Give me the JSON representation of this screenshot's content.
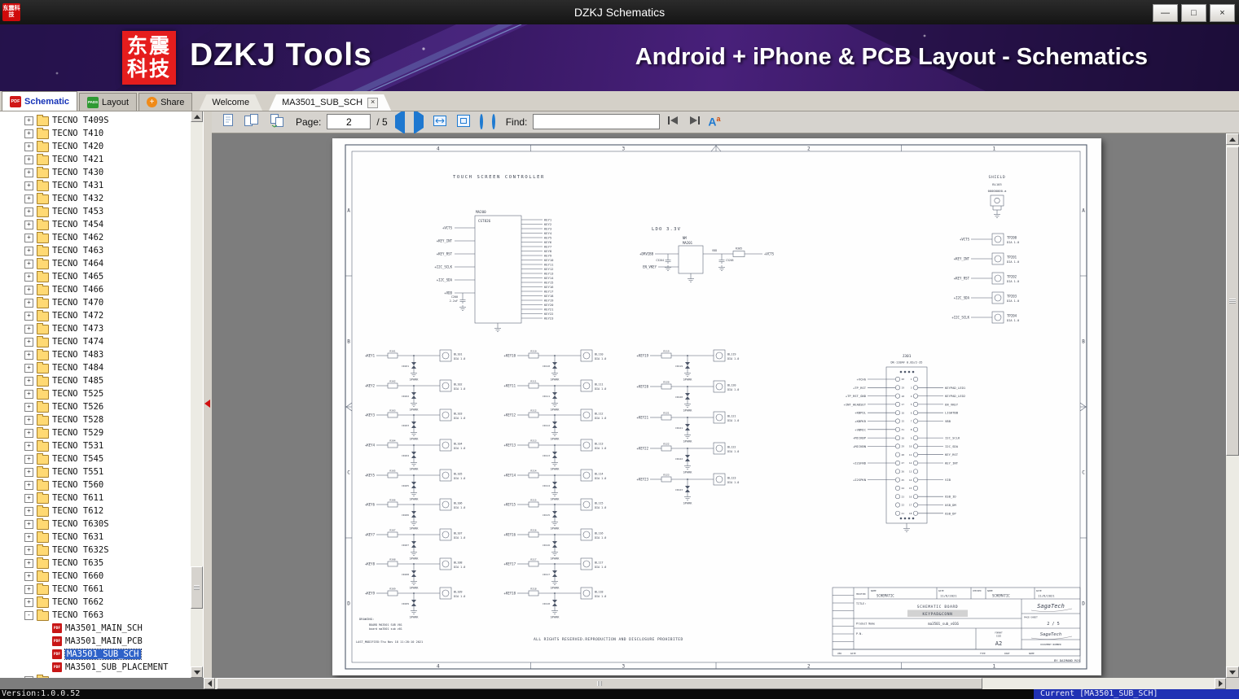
{
  "window": {
    "title": "DZKJ Schematics",
    "icon_text": "东震科技",
    "controls": {
      "minimize": "—",
      "maximize": "□",
      "close": "×"
    }
  },
  "banner": {
    "logo_line1": "东震",
    "logo_line2": "科技",
    "brand": "DZKJ Tools",
    "subtitle": "Android + iPhone & PCB Layout - Schematics"
  },
  "icons": {
    "pdf": "PDF",
    "pads": "PADS",
    "share": "+",
    "match_a": "A",
    "match_a_sup": "a"
  },
  "tabs": {
    "app": [
      {
        "label": "Schematic"
      },
      {
        "label": "Layout"
      },
      {
        "label": "Share"
      }
    ],
    "docs": [
      {
        "label": "Welcome"
      },
      {
        "label": "MA3501_SUB_SCH",
        "close": "×"
      }
    ]
  },
  "sidebar": {
    "folders": [
      "TECNO T409S",
      "TECNO T410",
      "TECNO T420",
      "TECNO T421",
      "TECNO T430",
      "TECNO T431",
      "TECNO T432",
      "TECNO T453",
      "TECNO T454",
      "TECNO T462",
      "TECNO T463",
      "TECNO T464",
      "TECNO T465",
      "TECNO T466",
      "TECNO T470",
      "TECNO T472",
      "TECNO T473",
      "TECNO T474",
      "TECNO T483",
      "TECNO T484",
      "TECNO T485",
      "TECNO T525",
      "TECNO T526",
      "TECNO T528",
      "TECNO T529",
      "TECNO T531",
      "TECNO T545",
      "TECNO T551",
      "TECNO T560",
      "TECNO T611",
      "TECNO T612",
      "TECNO T630S",
      "TECNO T631",
      "TECNO T632S",
      "TECNO T635",
      "TECNO T660",
      "TECNO T661",
      "TECNO T662",
      "TECNO T663"
    ],
    "expanded": "TECNO T663",
    "children": [
      {
        "label": "MA3501_MAIN_SCH",
        "selected": false
      },
      {
        "label": "MA3501_MAIN_PCB",
        "selected": false
      },
      {
        "label": "MA3501_SUB_SCH",
        "selected": true
      },
      {
        "label": "MA3501_SUB_PLACEMENT",
        "selected": false
      }
    ]
  },
  "toolbar": {
    "page_label": "Page:",
    "page_value": "2",
    "page_total": "/ 5",
    "find_label": "Find:",
    "find_value": ""
  },
  "statusbar": {
    "version": "Version:1.0.0.52",
    "current": "Current [MA3501_SUB_SCH]"
  },
  "schematic": {
    "frame": {
      "cols": [
        "4",
        "3",
        "2",
        "1"
      ],
      "rows": [
        "A",
        "B",
        "C",
        "D"
      ]
    },
    "touch": {
      "title": "TOUCH SCREEN CONTROLLER",
      "ref": "MA200",
      "part": "CST826",
      "left_nets": [
        "VCTS",
        "KEY_INT",
        "KEY_RST",
        "I2C_SCLK",
        "I2C_SDA",
        "VDD"
      ],
      "cap_ref": "C200",
      "cap_val": "2.2uF",
      "right_nets": [
        "KEY1",
        "KEY2",
        "KEY3",
        "KEY4",
        "KEY5",
        "KEY6",
        "KEY7",
        "KEY8",
        "KEY9",
        "KEY10",
        "KEY11",
        "KEY12",
        "KEY13",
        "KEY14",
        "KEY15",
        "KEY16",
        "KEY17",
        "KEY18",
        "KEY19",
        "KEY20",
        "KEY21",
        "KEY22",
        "KEY23"
      ]
    },
    "ldo": {
      "title": "LDO 3.3V",
      "nm": "NM",
      "ref": "MA201",
      "in_net": "DRVIBB",
      "en_net": "EN_VKEY",
      "mid_net": "VDD",
      "out_net": "VCTS",
      "res_ref": "R305",
      "cap1": "C3204",
      "cap2": "C3205"
    },
    "shield": {
      "title": "SHIELD",
      "ref": "BL103",
      "part": "00000000-a"
    },
    "testpoints": [
      {
        "net": "VCTS",
        "ref": "TP200",
        "dia": "DIA 1.0"
      },
      {
        "net": "KEY_INT",
        "ref": "TP201",
        "dia": "DIA 1.0"
      },
      {
        "net": "KEY_RST",
        "ref": "TP202",
        "dia": "DIA 1.0"
      },
      {
        "net": "I2C_SDA",
        "ref": "TP203",
        "dia": "DIA 1.0"
      },
      {
        "net": "I2C_SCLK",
        "ref": "TP204",
        "dia": "DIA 1.0"
      }
    ],
    "keypad": {
      "sw_note": "DIA 1.0",
      "spark": "SPARK",
      "col1": [
        {
          "net": "KEY1",
          "res": "R301",
          "cap": "CR101",
          "sw": "BL101"
        },
        {
          "net": "KEY2",
          "res": "R302",
          "cap": "CR102",
          "sw": "BL102"
        },
        {
          "net": "KEY3",
          "res": "R303",
          "cap": "CR103",
          "sw": "BL103"
        },
        {
          "net": "KEY4",
          "res": "R304",
          "cap": "CR104",
          "sw": "BL104"
        },
        {
          "net": "KEY5",
          "res": "R305",
          "cap": "CR105",
          "sw": "BL105"
        },
        {
          "net": "KEY6",
          "res": "R306",
          "cap": "CR106",
          "sw": "BL106"
        },
        {
          "net": "KEY7",
          "res": "R307",
          "cap": "CR107",
          "sw": "BL107"
        },
        {
          "net": "KEY8",
          "res": "R308",
          "cap": "CR108",
          "sw": "BL108"
        },
        {
          "net": "KEY9",
          "res": "R309",
          "cap": "CR109",
          "sw": "BL109"
        }
      ],
      "col2": [
        {
          "net": "KEY10",
          "res": "R310",
          "cap": "CR110",
          "sw": "BL110"
        },
        {
          "net": "KEY11",
          "res": "R311",
          "cap": "CR111",
          "sw": "BL111"
        },
        {
          "net": "KEY12",
          "res": "R312",
          "cap": "CR112",
          "sw": "BL112"
        },
        {
          "net": "KEY13",
          "res": "R313",
          "cap": "CR113",
          "sw": "BL113"
        },
        {
          "net": "KEY14",
          "res": "R314",
          "cap": "CR114",
          "sw": "BL114"
        },
        {
          "net": "KEY15",
          "res": "R315",
          "cap": "CR115",
          "sw": "BL115"
        },
        {
          "net": "KEY16",
          "res": "R316",
          "cap": "CR116",
          "sw": "BL116"
        },
        {
          "net": "KEY17",
          "res": "R317",
          "cap": "CR117",
          "sw": "BL117"
        },
        {
          "net": "KEY18",
          "res": "R318",
          "cap": "CR118",
          "sw": "BL118"
        }
      ],
      "col3": [
        {
          "net": "KEY19",
          "res": "R319",
          "cap": "CR119",
          "sw": "BL119"
        },
        {
          "net": "KEY20",
          "res": "R320",
          "cap": "CR120",
          "sw": "BL120"
        },
        {
          "net": "KEY21",
          "res": "R321",
          "cap": "CR121",
          "sw": "BL121"
        },
        {
          "net": "KEY22",
          "res": "R322",
          "cap": "CR122",
          "sw": "BL122"
        },
        {
          "net": "KEY23",
          "res": "R323",
          "cap": "CR123",
          "sw": "BL123"
        }
      ]
    },
    "connector": {
      "ref": "J301",
      "part": "DK-118AF 0.8S/2-35",
      "rows": [
        {
          "l": "20",
          "lnet": "VCHG",
          "r": "1",
          "rnet": ""
        },
        {
          "l": "19",
          "lnet": "TP_RST",
          "r": "3",
          "rnet": "KEYPAD_LED1"
        },
        {
          "l": "18",
          "lnet": "TP_RST_GND",
          "r": "4",
          "rnet": "KEYPAD_LED2"
        },
        {
          "l": "17",
          "lnet": "INT_HEADSET",
          "r": "5",
          "rnet": "EN_VKEY"
        },
        {
          "l": "16",
          "lnet": "KBPOL",
          "r": "6",
          "rnet": "LIGHTBB"
        },
        {
          "l": "15",
          "lnet": "KBPKR",
          "r": "7",
          "rnet": "VBB"
        },
        {
          "l": "31",
          "lnet": "VBMIC",
          "r": "8",
          "rnet": ""
        },
        {
          "l": "30",
          "lnet": "MICKBP",
          "r": "9",
          "rnet": "I2C_SCLK"
        },
        {
          "l": "29",
          "lnet": "MICKBN",
          "r": "10",
          "rnet": "I2C_SDA"
        },
        {
          "l": "28",
          "lnet": "",
          "r": "11",
          "rnet": "KEY_RST"
        },
        {
          "l": "27",
          "lnet": "I2SFND",
          "r": "12",
          "rnet": "KEY_INT"
        },
        {
          "l": "26",
          "lnet": "",
          "r": "13",
          "rnet": ""
        },
        {
          "l": "25",
          "lnet": "I2SPKN",
          "r": "14",
          "rnet": "VIB"
        },
        {
          "l": "24",
          "lnet": "",
          "r": "15",
          "rnet": ""
        },
        {
          "l": "23",
          "lnet": "",
          "r": "16",
          "rnet": "USB_ID"
        },
        {
          "l": "22",
          "lnet": "",
          "r": "17",
          "rnet": "USB_DM"
        },
        {
          "l": "21",
          "lnet": "",
          "r": "18",
          "rnet": "USB_DP"
        }
      ]
    },
    "notes": {
      "drawing": "DRAWING:",
      "line1": "BOARD MA3501 SUB V01",
      "line2": "board ma3501 sub v01",
      "modified": "LAST_MODIFIED:Thu Nov 18 11:28:10 2021",
      "rights": "ALL RIGHTS RESERVED.REPRODUCTION AND DISCLOSURE PROHIBITED"
    },
    "titleblock": {
      "modified_label": "MODIFIED",
      "name_label": "NAME",
      "date_label": "DATE",
      "checked_label": "CHECKED",
      "name1": "SCHEMATIC",
      "date1": "11/6/2021",
      "name2": "SCHEMATIC",
      "date2": "11/6/2021",
      "title_label": "TITLE:",
      "title1": "SCHEMATIC BOARD",
      "title2": "KEYPAD&CONN",
      "product_label": "Product Name",
      "product": "ma3501_sub_v016",
      "pn_label": "P.N.",
      "page_label": "PAGE-SHEET",
      "page": "2 / 5",
      "brand": "SagaTech",
      "format_label": "FORMAT",
      "size_label": "SIZE",
      "size": "A2",
      "doc_label": "DOCUMENT NUMBER",
      "ver_label": "VER",
      "date_small": "DATE",
      "type_label": "TYPE",
      "part_label": "PART",
      "name_small": "NAME",
      "by": "BY DAIMAND MJS"
    }
  }
}
